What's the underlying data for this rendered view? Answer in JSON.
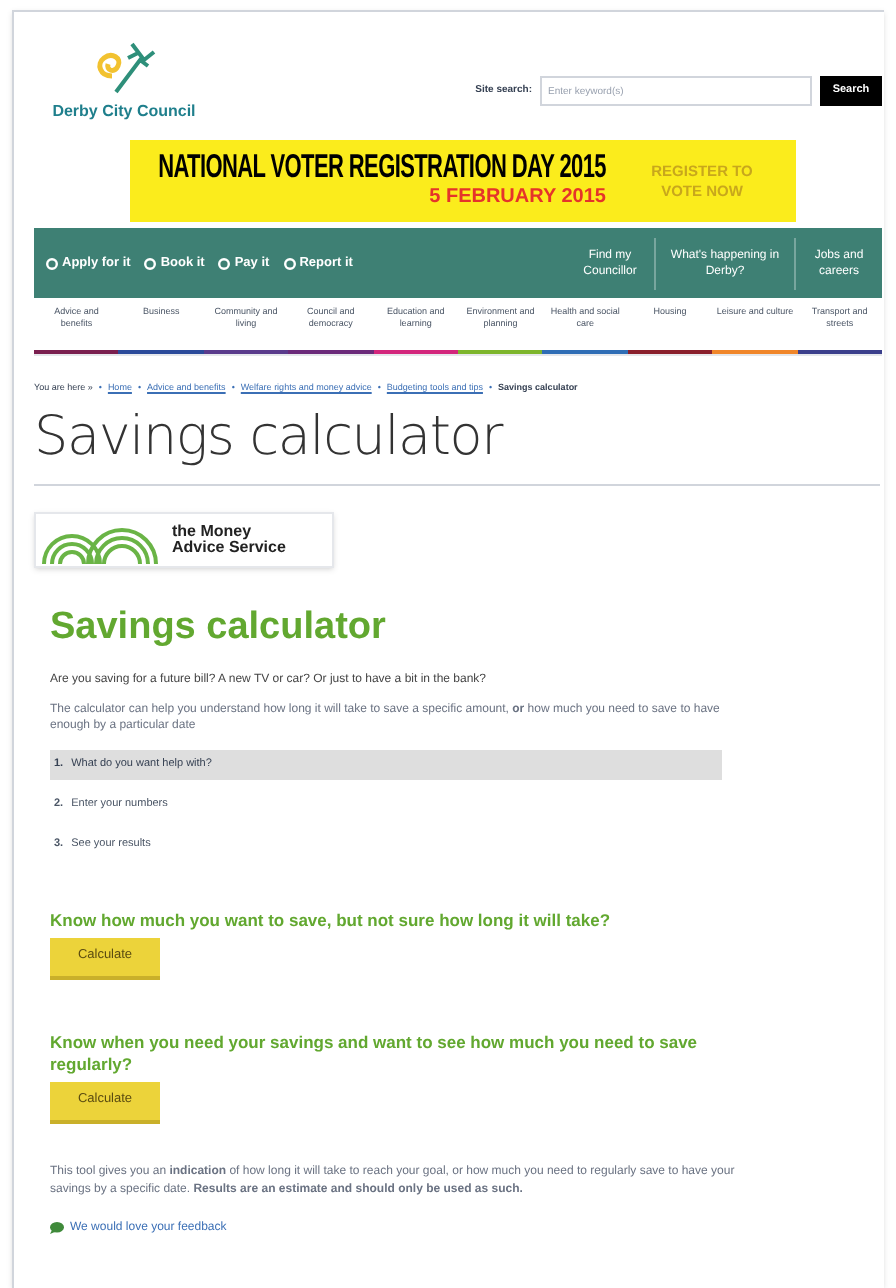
{
  "header": {
    "logo_text": "Derby City Council",
    "search": {
      "label": "Site search:",
      "placeholder": "Enter keyword(s)",
      "button": "Search"
    }
  },
  "banner": {
    "headline": "NATIONAL VOTER REGISTRATION DAY 2015",
    "date": "5 FEBRUARY 2015",
    "cta": "REGISTER TO VOTE NOW"
  },
  "top_nav": {
    "actions": [
      "Apply for it",
      "Book it",
      "Pay it",
      "Report it"
    ],
    "links": [
      "Find my Councillor",
      "What's happening in Derby?",
      "Jobs and careers"
    ]
  },
  "categories": [
    {
      "label": "Advice and benefits",
      "color": "#7a1f4f"
    },
    {
      "label": "Business",
      "color": "#2b4a9a"
    },
    {
      "label": "Community and living",
      "color": "#5a3b8c"
    },
    {
      "label": "Council and democracy",
      "color": "#6b2a7a"
    },
    {
      "label": "Education and learning",
      "color": "#d3267c"
    },
    {
      "label": "Environment and planning",
      "color": "#7db52c"
    },
    {
      "label": "Health and social care",
      "color": "#2f6db5"
    },
    {
      "label": "Housing",
      "color": "#8a1f2c"
    },
    {
      "label": "Leisure and culture",
      "color": "#f0862a"
    },
    {
      "label": "Transport and streets",
      "color": "#3b3f8c"
    }
  ],
  "breadcrumb": {
    "prefix": "You are here »",
    "separator": "•",
    "links": [
      "Home",
      "Advice and benefits",
      "Welfare rights and money advice",
      "Budgeting tools and tips"
    ],
    "current": "Savings calculator"
  },
  "page_title": "Savings calculator",
  "partner_logo": {
    "line1": "the Money",
    "line2": "Advice Service"
  },
  "calculator": {
    "title": "Savings calculator",
    "question": "Are you saving for a future bill? A new TV or car? Or just to have a bit in the bank?",
    "intro": "The calculator can help you understand how long it will take to save a specific amount, **or** how much you need to save to have enough by a particular date",
    "steps": [
      {
        "number": "1.",
        "label": "What do you want help with?",
        "selected": true
      },
      {
        "number": "2.",
        "label": "Enter your numbers",
        "selected": false
      },
      {
        "number": "3.",
        "label": "See your results",
        "selected": false
      }
    ],
    "options": [
      {
        "heading": "Know how much you want to save, but not sure how long it will take?",
        "button": "Calculate"
      },
      {
        "heading": "Know when you need your savings and want to see how much you need to save regularly?",
        "button": "Calculate"
      }
    ],
    "disclaimer": "This tool gives you an **indication** of how long it will take to reach your goal, or how much you need to regularly save to have your savings by a specific date. **Results are an estimate and should only be used as such.**",
    "feedback": "We would love your feedback"
  }
}
